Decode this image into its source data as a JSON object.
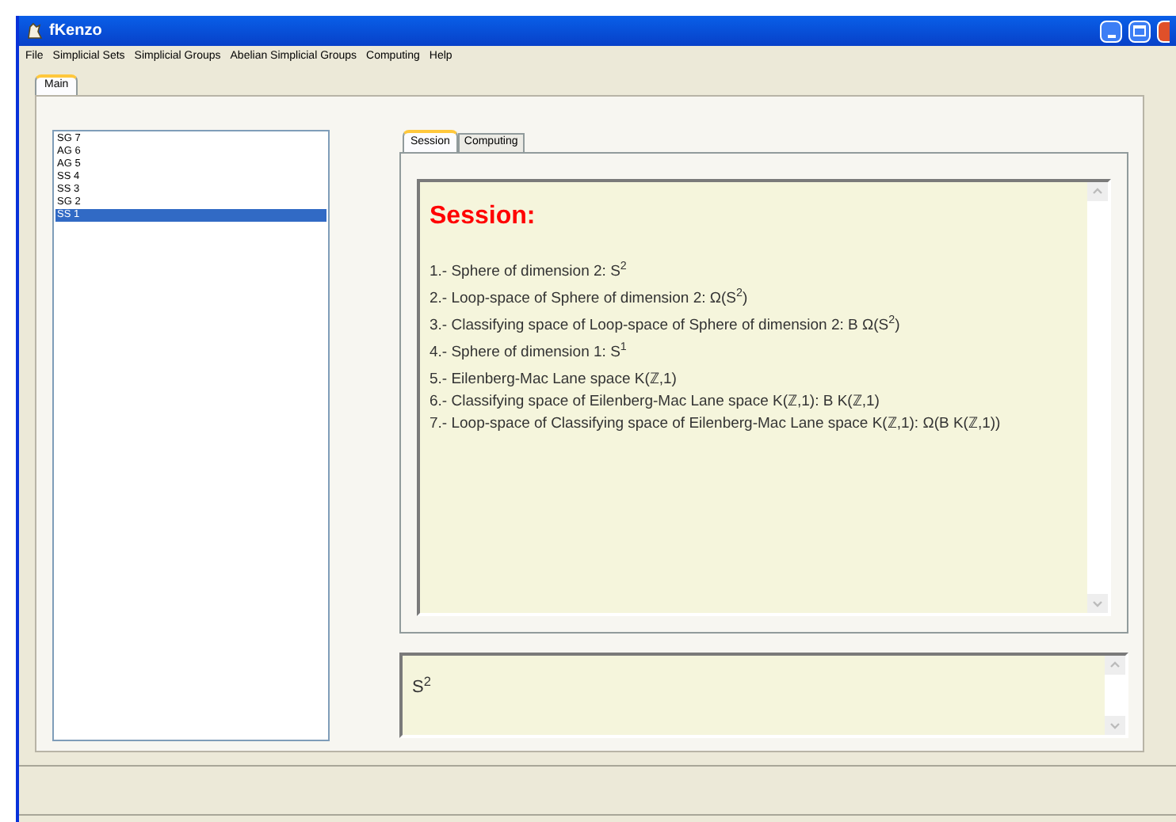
{
  "window": {
    "title": "fKenzo"
  },
  "menu": [
    "File",
    "Simplicial Sets",
    "Simplicial Groups",
    "Abelian Simplicial Groups",
    "Computing",
    "Help"
  ],
  "main_tabs": [
    {
      "label": "Main",
      "selected": true
    }
  ],
  "objects": [
    {
      "label": "SG 7",
      "selected": false
    },
    {
      "label": "AG 6",
      "selected": false
    },
    {
      "label": "AG 5",
      "selected": false
    },
    {
      "label": "SS 4",
      "selected": false
    },
    {
      "label": "SS 3",
      "selected": false
    },
    {
      "label": "SG 2",
      "selected": false
    },
    {
      "label": "SS 1",
      "selected": true
    }
  ],
  "panel_tabs": [
    {
      "label": "Session",
      "selected": true
    },
    {
      "label": "Computing",
      "selected": false
    }
  ],
  "session": {
    "heading": "Session:",
    "lines": [
      "1.- Sphere of dimension 2: S$^{2}$",
      "2.- Loop-space of Sphere of dimension 2: Ω(S$^{2}$)",
      "3.- Classifying space of Loop-space of Sphere of dimension 2: B Ω(S$^{2}$)",
      "4.- Sphere of dimension 1: S$^{1}$",
      "5.- Eilenberg-Mac Lane space K(ℤ,1)",
      "6.- Classifying space of Eilenberg-Mac Lane space K(ℤ,1): B K(ℤ,1)",
      "7.- Loop-space of Classifying space of Eilenberg-Mac Lane space K(ℤ,1): Ω(B K(ℤ,1))"
    ]
  },
  "output": "S$^{2}$"
}
